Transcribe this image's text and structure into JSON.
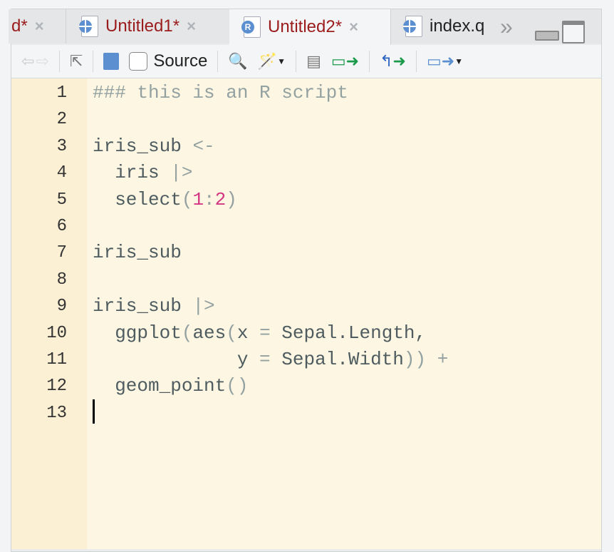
{
  "tabs": [
    {
      "label": "d*",
      "close": "×",
      "icon": "none",
      "active": false,
      "modified": true
    },
    {
      "label": "Untitled1*",
      "close": "×",
      "icon": "quarto-doc-icon",
      "active": false,
      "modified": true
    },
    {
      "label": "Untitled2*",
      "close": "×",
      "icon": "r-script-icon",
      "icon_text": "R",
      "active": true,
      "modified": true
    },
    {
      "label": "index.q",
      "close": "",
      "icon": "quarto-doc-icon",
      "active": false,
      "modified": false
    }
  ],
  "tab_overflow": "»",
  "toolbar": {
    "source_label": "Source",
    "source_checked": false
  },
  "editor": {
    "lines": [
      {
        "n": "1",
        "tokens": [
          {
            "t": "### this is an R script",
            "c": "comment"
          }
        ]
      },
      {
        "n": "2",
        "tokens": []
      },
      {
        "n": "3",
        "tokens": [
          {
            "t": "iris_sub ",
            "c": ""
          },
          {
            "t": "<-",
            "c": "op"
          }
        ]
      },
      {
        "n": "4",
        "tokens": [
          {
            "t": "  iris ",
            "c": ""
          },
          {
            "t": "|>",
            "c": "op"
          }
        ]
      },
      {
        "n": "5",
        "tokens": [
          {
            "t": "  select",
            "c": ""
          },
          {
            "t": "(",
            "c": "paren"
          },
          {
            "t": "1",
            "c": "num"
          },
          {
            "t": ":",
            "c": "op"
          },
          {
            "t": "2",
            "c": "num"
          },
          {
            "t": ")",
            "c": "paren"
          }
        ]
      },
      {
        "n": "6",
        "tokens": []
      },
      {
        "n": "7",
        "tokens": [
          {
            "t": "iris_sub",
            "c": ""
          }
        ]
      },
      {
        "n": "8",
        "tokens": []
      },
      {
        "n": "9",
        "tokens": [
          {
            "t": "iris_sub ",
            "c": ""
          },
          {
            "t": "|>",
            "c": "op"
          }
        ]
      },
      {
        "n": "10",
        "tokens": [
          {
            "t": "  ggplot",
            "c": ""
          },
          {
            "t": "(",
            "c": "paren"
          },
          {
            "t": "aes",
            "c": ""
          },
          {
            "t": "(",
            "c": "paren"
          },
          {
            "t": "x ",
            "c": ""
          },
          {
            "t": "=",
            "c": "op"
          },
          {
            "t": " Sepal.Length,",
            "c": ""
          }
        ]
      },
      {
        "n": "11",
        "tokens": [
          {
            "t": "             y ",
            "c": ""
          },
          {
            "t": "=",
            "c": "op"
          },
          {
            "t": " Sepal.Width",
            "c": ""
          },
          {
            "t": "))",
            "c": "paren"
          },
          {
            "t": " +",
            "c": "op"
          }
        ]
      },
      {
        "n": "12",
        "tokens": [
          {
            "t": "  geom_point",
            "c": ""
          },
          {
            "t": "()",
            "c": "paren"
          }
        ]
      },
      {
        "n": "13",
        "tokens": []
      }
    ]
  }
}
